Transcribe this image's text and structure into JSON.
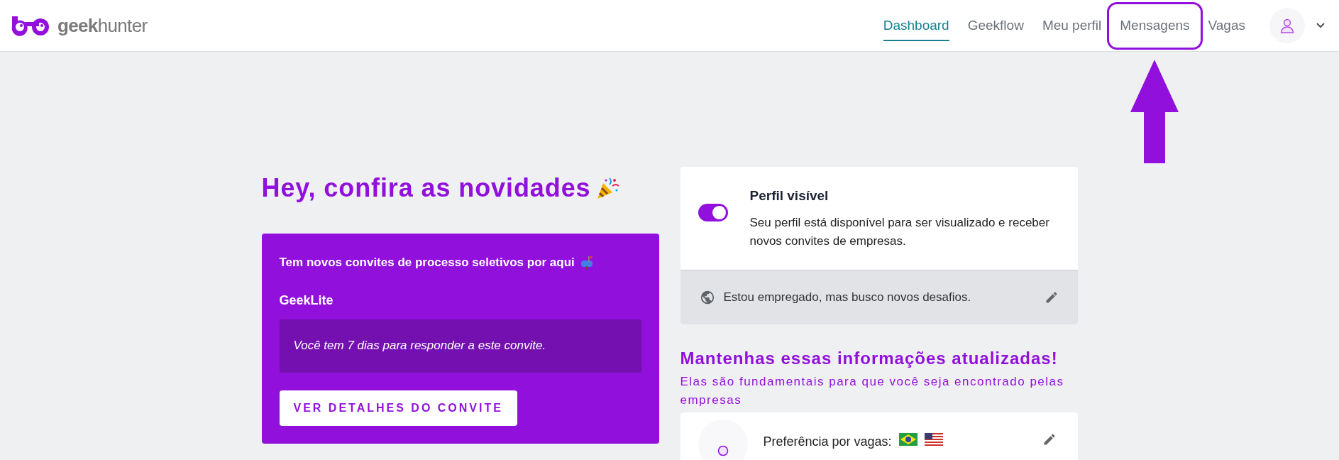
{
  "header": {
    "brand": {
      "bold": "geek",
      "light": "hunter"
    },
    "nav": [
      {
        "label": "Dashboard",
        "selected": true,
        "highlighted": false
      },
      {
        "label": "Geekflow",
        "selected": false,
        "highlighted": false
      },
      {
        "label": "Meu perfil",
        "selected": false,
        "highlighted": false
      },
      {
        "label": "Mensagens",
        "selected": false,
        "highlighted": true
      },
      {
        "label": "Vagas",
        "selected": false,
        "highlighted": false
      }
    ]
  },
  "news": {
    "title": "Hey, confira as novidades",
    "card": {
      "intro": "Tem novos convites de processo seletivos por aqui",
      "company": "GeekLite",
      "notice": "Você tem 7 dias para responder a este convite.",
      "button": "VER DETALHES DO CONVITE"
    }
  },
  "visibility": {
    "title": "Perfil visível",
    "on": true,
    "description": "Seu perfil está disponível para ser visualizado e receber novos convites de empresas.",
    "status": "Estou empregado, mas busco novos desafios."
  },
  "update": {
    "title": "Mantenhas essas informações atualizadas!",
    "subtitle": "Elas são fundamentais para que você seja encontrado pelas empresas",
    "item": {
      "label": "Preferência por vagas:"
    }
  }
}
